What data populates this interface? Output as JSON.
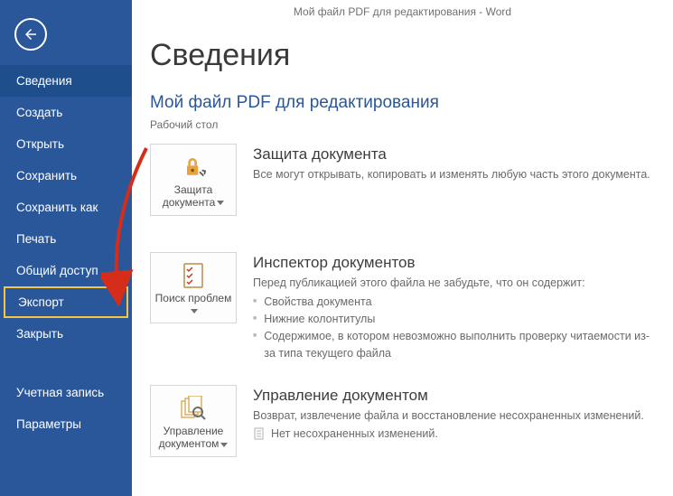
{
  "window_title": "Мой файл PDF для редактирования - Word",
  "nav": {
    "back": "Назад",
    "items": [
      "Сведения",
      "Создать",
      "Открыть",
      "Сохранить",
      "Сохранить как",
      "Печать",
      "Общий доступ",
      "Экспорт",
      "Закрыть"
    ],
    "footer": [
      "Учетная запись",
      "Параметры"
    ]
  },
  "page": {
    "title": "Сведения",
    "file_name": "Мой файл PDF для редактирования",
    "file_location": "Рабочий стол"
  },
  "sections": {
    "protect": {
      "tile": "Защита документа",
      "heading": "Защита документа",
      "desc": "Все могут открывать, копировать и изменять любую часть этого документа."
    },
    "inspect": {
      "tile": "Поиск проблем",
      "heading": "Инспектор документов",
      "intro": "Перед публикацией этого файла не забудьте, что он содержит:",
      "bullets": [
        "Свойства документа",
        "Нижние колонтитулы",
        "Содержимое, в котором невозможно выполнить проверку читаемости из-за типа текущего файла"
      ]
    },
    "manage": {
      "tile": "Управление документом",
      "heading": "Управление документом",
      "desc": "Возврат, извлечение файла и восстановление несохраненных изменений.",
      "status": "Нет несохраненных изменений."
    }
  }
}
